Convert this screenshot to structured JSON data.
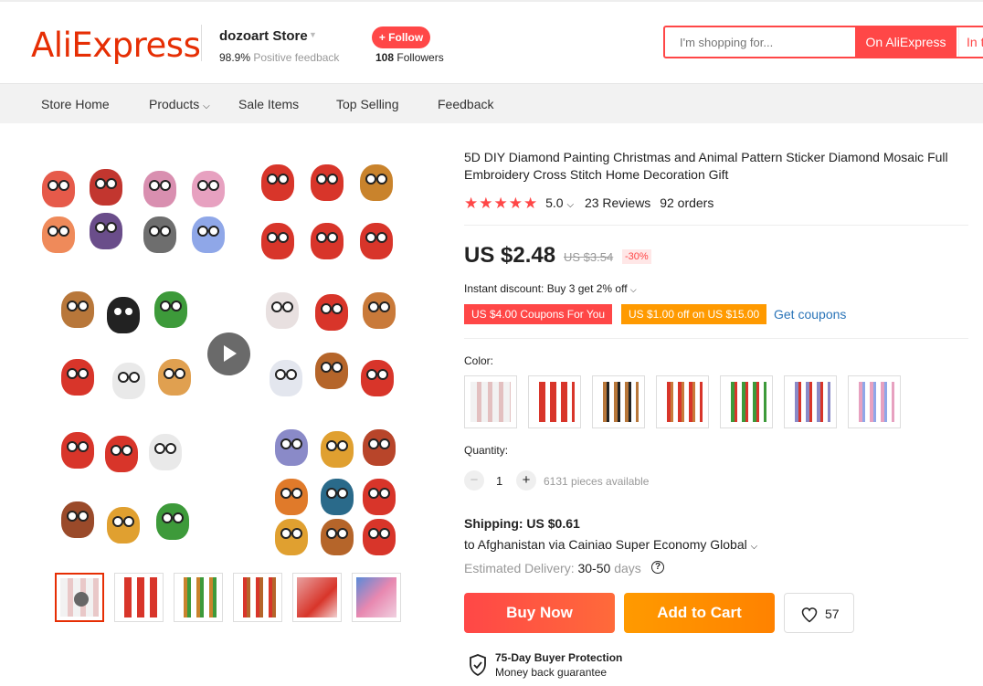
{
  "header": {
    "logo": "AliExpress",
    "store_name": "dozoart Store",
    "feedback_pct": "98.9%",
    "feedback_label": "Positive feedback",
    "follow_label": "+ Follow",
    "followers_count": "108",
    "followers_label": "Followers",
    "search_placeholder": "I'm shopping for...",
    "search_btn_aliexpress": "On AliExpress",
    "search_btn_store": "In t"
  },
  "nav": {
    "items": [
      "Store Home",
      "Products",
      "Sale Items",
      "Top Selling",
      "Feedback"
    ]
  },
  "product": {
    "title": "5D DIY Diamond Painting Christmas and Animal Pattern Sticker Diamond Mosaic Full Embroidery Cross Stitch Home Decoration Gift",
    "stars": "★★★★★",
    "rating": "5.0",
    "reviews": "23 Reviews",
    "orders": "92 orders",
    "price": "US $2.48",
    "original_price": "US $3.54",
    "discount": "-30%",
    "instant_discount": "Instant discount: Buy 3 get 2% off",
    "coupon1": "US $4.00 Coupons For You",
    "coupon2": "US $1.00 off on US $15.00",
    "get_coupons": "Get coupons",
    "color_label": "Color:",
    "quantity_label": "Quantity:",
    "quantity": "1",
    "available": "6131 pieces available",
    "shipping_title": "Shipping: US $0.61",
    "shipping_dest": "to Afghanistan via Cainiao Super Economy Global",
    "est_label": "Estimated Delivery:",
    "est_days": "30-50",
    "est_unit": "days",
    "buy_now": "Buy Now",
    "add_to_cart": "Add to Cart",
    "wishlist_count": "57",
    "protection_title": "75-Day Buyer Protection",
    "protection_sub": "Money back guarantee"
  },
  "colors": {
    "accent": "#ff4747",
    "brand": "#e62e04",
    "orange": "#ff9a00",
    "link": "#2a74b8"
  },
  "icons": [
    "play-icon",
    "chevron-down-icon",
    "star-icon",
    "minus-icon",
    "plus-icon",
    "help-icon",
    "heart-icon",
    "shield-icon"
  ]
}
